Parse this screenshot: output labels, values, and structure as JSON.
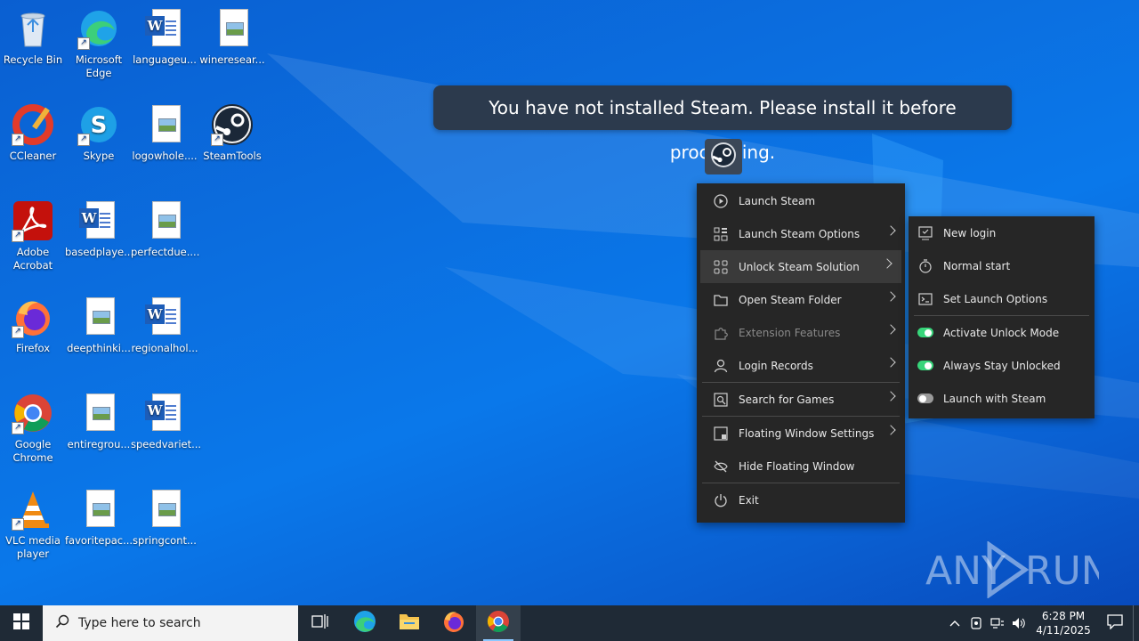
{
  "desktop": {
    "icons": [
      {
        "label": "Recycle Bin",
        "icon": "recycle-bin-icon"
      },
      {
        "label": "Microsoft Edge",
        "icon": "edge-icon"
      },
      {
        "label": "languageu...",
        "icon": "word-doc-icon"
      },
      {
        "label": "wineresear...",
        "icon": "image-file-icon"
      },
      {
        "label": "CCleaner",
        "icon": "ccleaner-icon"
      },
      {
        "label": "Skype",
        "icon": "skype-icon"
      },
      {
        "label": "logowhole....",
        "icon": "image-file-icon"
      },
      {
        "label": "SteamTools",
        "icon": "steam-icon"
      },
      {
        "label": "Adobe Acrobat",
        "icon": "acrobat-icon"
      },
      {
        "label": "basedplaye...",
        "icon": "word-doc-icon"
      },
      {
        "label": "perfectdue....",
        "icon": "image-file-icon"
      },
      {
        "label": "Firefox",
        "icon": "firefox-icon"
      },
      {
        "label": "deepthinki...",
        "icon": "image-file-icon"
      },
      {
        "label": "regionalhol...",
        "icon": "word-doc-icon"
      },
      {
        "label": "Google Chrome",
        "icon": "chrome-icon"
      },
      {
        "label": "entiregrou...",
        "icon": "image-file-icon"
      },
      {
        "label": "speedvariet...",
        "icon": "word-doc-icon"
      },
      {
        "label": "VLC media player",
        "icon": "vlc-icon"
      },
      {
        "label": "favoritepac...",
        "icon": "image-file-icon"
      },
      {
        "label": "springcont...",
        "icon": "image-file-icon"
      }
    ]
  },
  "toast": {
    "message": "You have not installed Steam. Please install it before proceeding."
  },
  "main_menu": {
    "items": [
      {
        "label": "Launch Steam",
        "icon": "play-circle-icon"
      },
      {
        "label": "Launch Steam Options",
        "icon": "options-grid-icon"
      },
      {
        "label": "Unlock Steam Solution",
        "icon": "unlock-grid-icon"
      },
      {
        "label": "Open Steam Folder",
        "icon": "folder-icon"
      },
      {
        "label": "Extension Features",
        "icon": "puzzle-icon"
      },
      {
        "label": "Login Records",
        "icon": "user-icon"
      },
      {
        "label": "Search for Games",
        "icon": "search-games-icon"
      },
      {
        "label": "Floating Window Settings",
        "icon": "window-icon"
      },
      {
        "label": "Hide Floating Window",
        "icon": "eye-off-icon"
      },
      {
        "label": "Exit",
        "icon": "power-icon"
      }
    ]
  },
  "sub_menu": {
    "items": [
      {
        "label": "New login",
        "icon": "monitor-check-icon"
      },
      {
        "label": "Normal start",
        "icon": "timer-icon"
      },
      {
        "label": "Set Launch Options",
        "icon": "terminal-icon"
      },
      {
        "label": "Activate Unlock Mode",
        "toggle": true
      },
      {
        "label": "Always Stay Unlocked",
        "toggle": true
      },
      {
        "label": "Launch with Steam",
        "toggle": false
      }
    ]
  },
  "watermark": {
    "text_left": "ANY",
    "text_right": "RUN"
  },
  "taskbar": {
    "search_placeholder": "Type here to search",
    "time": "6:28 PM",
    "date": "4/11/2025"
  },
  "colors": {
    "toggle_on": "#37d57a",
    "toggle_off": "#9b9b9b",
    "menu_bg": "#262626",
    "toast_bg": "#2c3a4d"
  }
}
